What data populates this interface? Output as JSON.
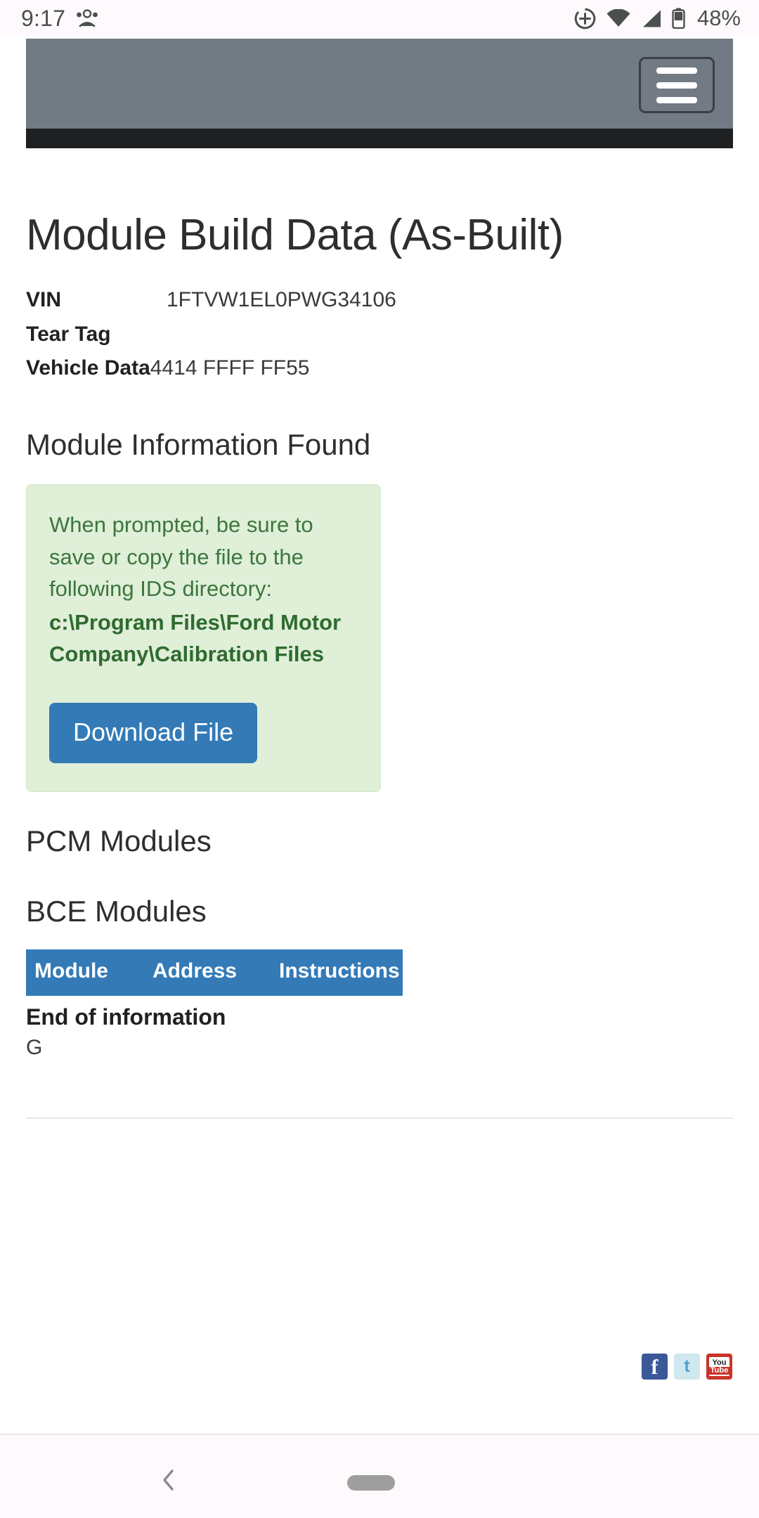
{
  "status_bar": {
    "time": "9:17",
    "people_icon": "people-icon",
    "icons": [
      "screen-record-icon",
      "wifi-icon",
      "cellular-signal-icon",
      "battery-icon"
    ],
    "battery_percent": "48%"
  },
  "site_header": {
    "menu_button_label": "menu-toggle",
    "bar_color": "#727a83",
    "strip_color": "#1f2021"
  },
  "page": {
    "title": "Module Build Data (As-Built)",
    "vehicle_info": [
      {
        "label": "VIN",
        "value": "1FTVW1EL0PWG34106"
      },
      {
        "label": "Tear Tag",
        "value": ""
      },
      {
        "label": "Vehicle Data",
        "value": "4414 FFFF FF55"
      }
    ],
    "module_info_heading": "Module Information Found",
    "alert": {
      "message": "When prompted, be sure to save or copy the file to the following IDS directory:",
      "path": "c:\\Program Files\\Ford Motor Company\\Calibration Files",
      "background_color": "#dfefd8",
      "text_color": "#3c763d",
      "download_label": "Download File",
      "download_color": "#337ab7"
    },
    "pcm_heading": "PCM Modules",
    "bce_heading": "BCE Modules",
    "table": {
      "header_color": "#337ab7",
      "columns": [
        "Module",
        "Address",
        "Instructions"
      ],
      "rows": []
    },
    "end_of_information": "End of information",
    "trailing_text": "G"
  },
  "footer": {
    "social": [
      {
        "name": "facebook-icon",
        "glyph": "f"
      },
      {
        "name": "twitter-icon",
        "glyph": "t"
      },
      {
        "name": "youtube-icon",
        "top": "You",
        "bottom": "Tube"
      }
    ]
  },
  "system_nav": {
    "back_label": "back-button",
    "home_label": "home-indicator"
  }
}
